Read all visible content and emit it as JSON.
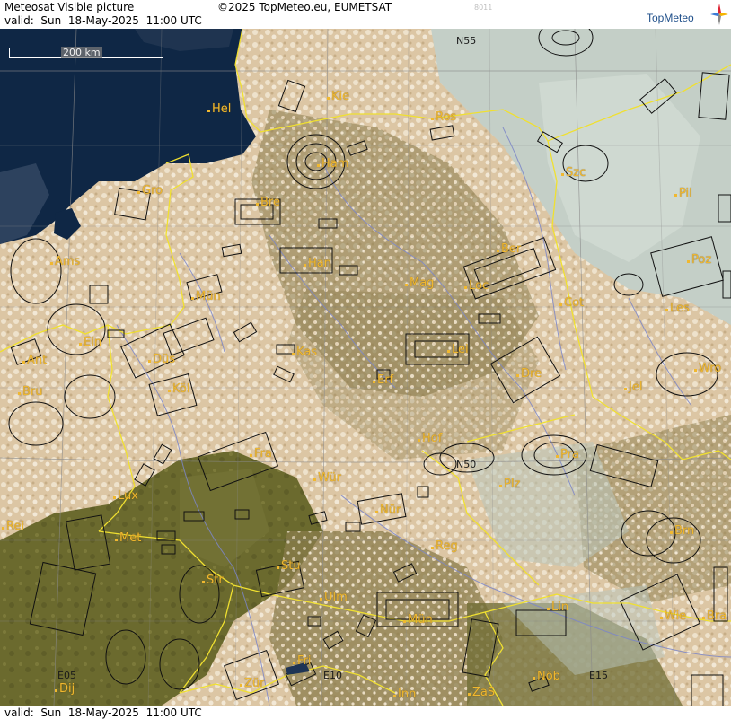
{
  "header": {
    "title": "Meteosat Visible picture",
    "copyright": "©2025 TopMeteo.eu, EUMETSAT",
    "code": "8011",
    "valid_top": "valid:  Sun  18-May-2025  11:00 UTC",
    "logo_text": "TopMeteo"
  },
  "footer": {
    "valid_bottom": "valid:  Sun  18-May-2025  11:00 UTC"
  },
  "scale": {
    "label": "200 km"
  },
  "grid_labels": {
    "n55": "N55",
    "n50": "N50",
    "e05": "E05",
    "e10": "E10",
    "e15": "E15"
  },
  "cities": [
    {
      "id": "hel",
      "name": "Hel"
    },
    {
      "id": "kie",
      "name": "Kie"
    },
    {
      "id": "ros",
      "name": "Ros"
    },
    {
      "id": "ham",
      "name": "Ham"
    },
    {
      "id": "szc",
      "name": "Szc"
    },
    {
      "id": "gro",
      "name": "Gro"
    },
    {
      "id": "bre",
      "name": "Bre"
    },
    {
      "id": "pil",
      "name": "Pil"
    },
    {
      "id": "ams",
      "name": "Ams"
    },
    {
      "id": "han",
      "name": "Han"
    },
    {
      "id": "ber",
      "name": "Ber"
    },
    {
      "id": "poz",
      "name": "Poz"
    },
    {
      "id": "mun",
      "name": "Mün"
    },
    {
      "id": "mag",
      "name": "Mag"
    },
    {
      "id": "loc",
      "name": "Loc"
    },
    {
      "id": "cot",
      "name": "Cot"
    },
    {
      "id": "les",
      "name": "Les"
    },
    {
      "id": "ein",
      "name": "Ein"
    },
    {
      "id": "kas",
      "name": "Kas"
    },
    {
      "id": "lei",
      "name": "Lei"
    },
    {
      "id": "ant",
      "name": "Ant"
    },
    {
      "id": "dus",
      "name": "Düs"
    },
    {
      "id": "dre",
      "name": "Dre"
    },
    {
      "id": "wro",
      "name": "Wro"
    },
    {
      "id": "bru",
      "name": "Bru"
    },
    {
      "id": "kol",
      "name": "Köl"
    },
    {
      "id": "erf",
      "name": "Erf"
    },
    {
      "id": "jel",
      "name": "Jel"
    },
    {
      "id": "hof",
      "name": "Hof"
    },
    {
      "id": "fra",
      "name": "Fra"
    },
    {
      "id": "pra",
      "name": "Pra"
    },
    {
      "id": "wur",
      "name": "Wür"
    },
    {
      "id": "plz",
      "name": "Plz"
    },
    {
      "id": "lux",
      "name": "Lux"
    },
    {
      "id": "nur",
      "name": "Nür"
    },
    {
      "id": "rei",
      "name": "Rei"
    },
    {
      "id": "met",
      "name": "Met"
    },
    {
      "id": "reg",
      "name": "Reg"
    },
    {
      "id": "brn",
      "name": "Brn"
    },
    {
      "id": "stu",
      "name": "Stu"
    },
    {
      "id": "str",
      "name": "Str"
    },
    {
      "id": "ulm",
      "name": "Ulm"
    },
    {
      "id": "lin",
      "name": "Lin"
    },
    {
      "id": "mue",
      "name": "Mün"
    },
    {
      "id": "wie",
      "name": "Wie"
    },
    {
      "id": "bra",
      "name": "Bra"
    },
    {
      "id": "fri",
      "name": "Fri"
    },
    {
      "id": "dij",
      "name": "Dij"
    },
    {
      "id": "zur",
      "name": "Zür"
    },
    {
      "id": "inn",
      "name": "Inn"
    },
    {
      "id": "zas",
      "name": "ZaS"
    },
    {
      "id": "nob",
      "name": "Nöb"
    }
  ]
}
